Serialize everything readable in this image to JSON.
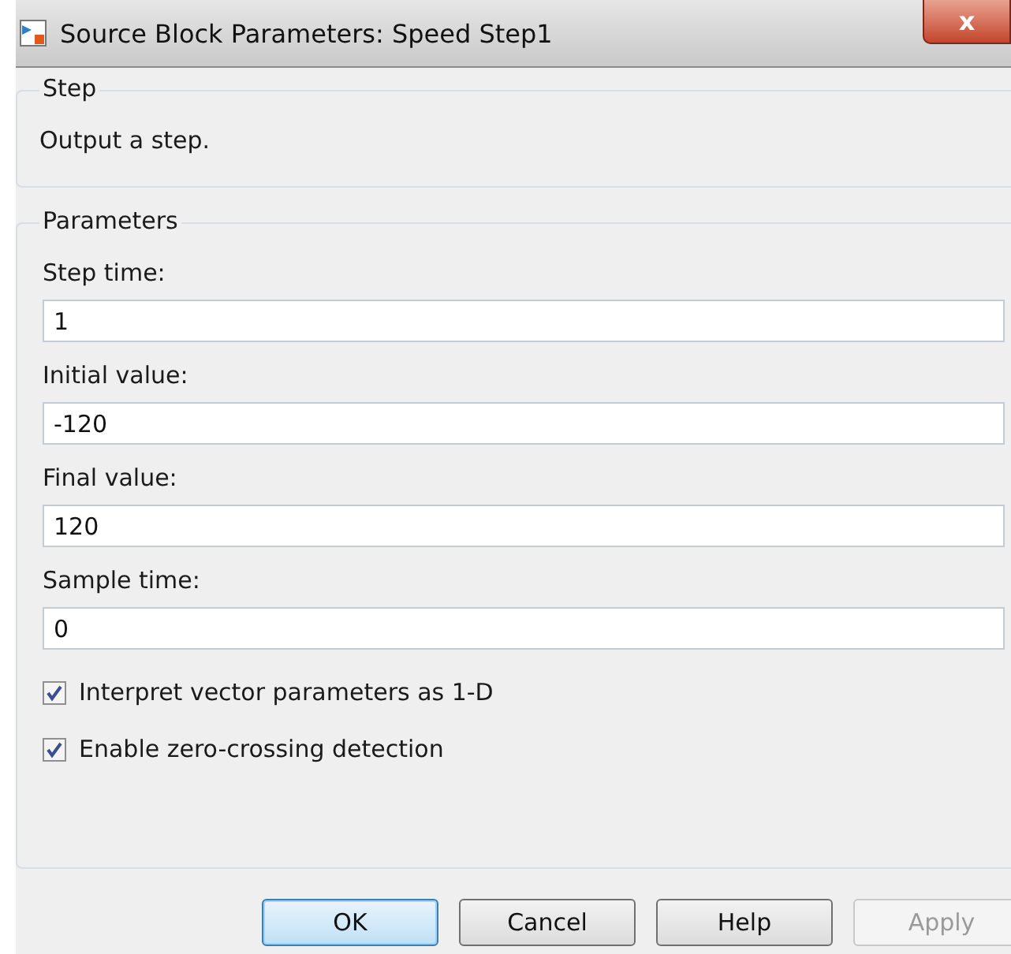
{
  "window": {
    "title": "Source Block Parameters: Speed Step1",
    "close": "x"
  },
  "step_group": {
    "title": "Step",
    "description": "Output a step."
  },
  "parameters_group": {
    "title": "Parameters",
    "fields": [
      {
        "label": "Step time:",
        "value": "1"
      },
      {
        "label": "Initial value:",
        "value": "-120"
      },
      {
        "label": "Final value:",
        "value": "120"
      },
      {
        "label": "Sample time:",
        "value": "0"
      }
    ],
    "checkboxes": [
      {
        "label": "Interpret vector parameters as 1-D",
        "checked": true
      },
      {
        "label": "Enable zero-crossing detection",
        "checked": true
      }
    ]
  },
  "buttons": [
    {
      "label": "OK",
      "default": true,
      "disabled": false
    },
    {
      "label": "Cancel",
      "default": false,
      "disabled": false
    },
    {
      "label": "Help",
      "default": false,
      "disabled": false
    },
    {
      "label": "Apply",
      "default": false,
      "disabled": true
    }
  ]
}
